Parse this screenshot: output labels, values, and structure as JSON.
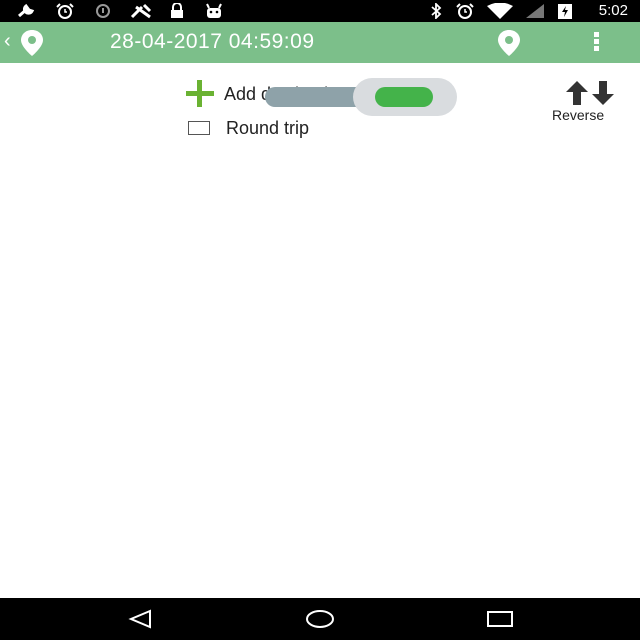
{
  "status_bar": {
    "time": "5:02",
    "icons_left": [
      "wrench-icon",
      "alarm-icon",
      "info-icon",
      "gps-icon",
      "lock-icon",
      "android-icon"
    ],
    "icons_right": [
      "bluetooth-icon",
      "alarm-icon",
      "wifi-icon",
      "signal-icon",
      "battery-charging-icon"
    ]
  },
  "app_bar": {
    "title": "28-04-2017 04:59:09",
    "background_color": "#7cbf8a"
  },
  "content": {
    "add_destination_label": "Add destination",
    "round_trip_label": "Round trip",
    "round_trip_checked": false,
    "reverse_label": "Reverse",
    "toggle_on": true,
    "accent_color": "#6ab232"
  },
  "nav_bar": {
    "buttons": [
      "back-icon",
      "home-icon",
      "recents-icon"
    ]
  }
}
